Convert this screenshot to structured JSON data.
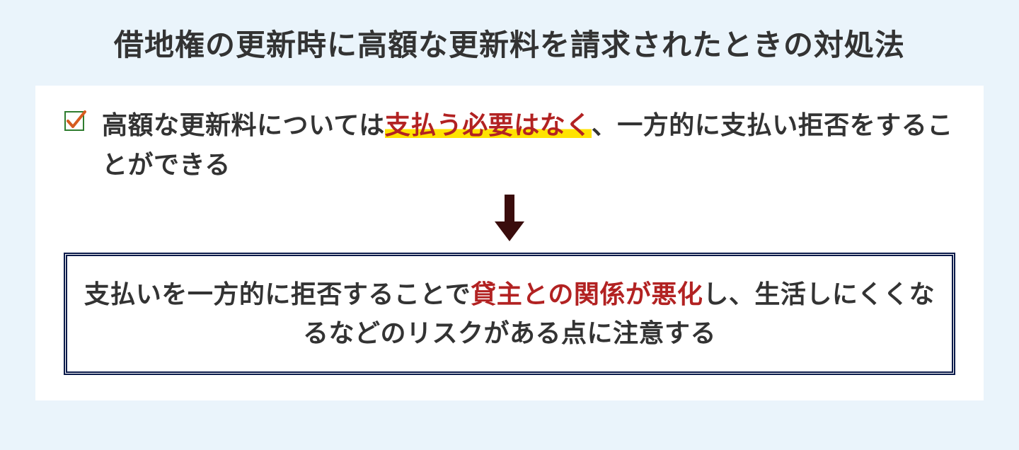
{
  "title": "借地権の更新時に高額な更新料を請求されたときの対処法",
  "point": {
    "part1": "高額な更新料については",
    "highlight": "支払う必要はなく",
    "part2": "、一方的に支払い拒否をすることができる"
  },
  "warning": {
    "part1": "支払いを一方的に拒否することで",
    "red1": "貸主との関係が悪化",
    "part2": "し、生活しにくくなるなどのリスクがある点に注意する"
  }
}
